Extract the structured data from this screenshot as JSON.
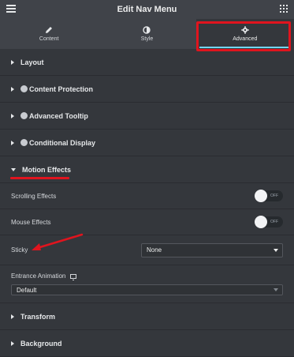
{
  "header": {
    "title": "Edit Nav Menu",
    "menu_icon": "hamburger-icon",
    "apps_icon": "grid-icon"
  },
  "tabs": [
    {
      "label": "Content",
      "icon": "pencil-icon"
    },
    {
      "label": "Style",
      "icon": "half-circle-icon"
    },
    {
      "label": "Advanced",
      "icon": "gear-icon",
      "active": true
    }
  ],
  "sections_top": [
    {
      "label": "Layout",
      "badge": false
    },
    {
      "label": "Content Protection",
      "badge": true
    },
    {
      "label": "Advanced Tooltip",
      "badge": true
    },
    {
      "label": "Conditional Display",
      "badge": true
    }
  ],
  "motion": {
    "label": "Motion Effects",
    "scrolling_label": "Scrolling Effects",
    "scrolling_state": "OFF",
    "mouse_label": "Mouse Effects",
    "mouse_state": "OFF",
    "sticky_label": "Sticky",
    "sticky_value": "None",
    "entrance_label": "Entrance Animation",
    "entrance_value": "Default"
  },
  "sections_bottom": [
    {
      "label": "Transform"
    },
    {
      "label": "Background"
    }
  ],
  "colors": {
    "accent": "#71d7f7",
    "annotation": "#e0141e"
  }
}
